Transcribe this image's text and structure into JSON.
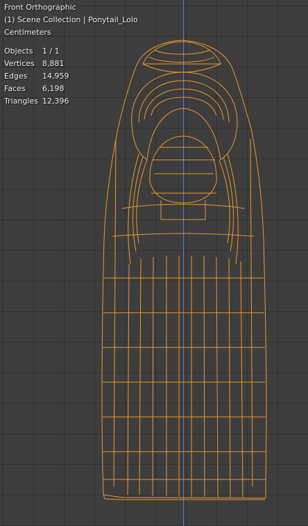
{
  "header": {
    "view_name": "Front Orthographic",
    "collection_info": "(1) Scene Collection | Ponytail_Lolo",
    "units": "Centimeters"
  },
  "stats": [
    {
      "label": "Objects",
      "value": "1 / 1"
    },
    {
      "label": "Vertices",
      "value": "8,881"
    },
    {
      "label": "Edges",
      "value": "14,959"
    },
    {
      "label": "Faces",
      "value": "6,198"
    },
    {
      "label": "Triangles",
      "value": "12,396"
    }
  ],
  "colors": {
    "background": "#3d3d3d",
    "wireframe": "#f0982c",
    "axis": "#5b7fc2",
    "text": "#f0f0f0"
  }
}
